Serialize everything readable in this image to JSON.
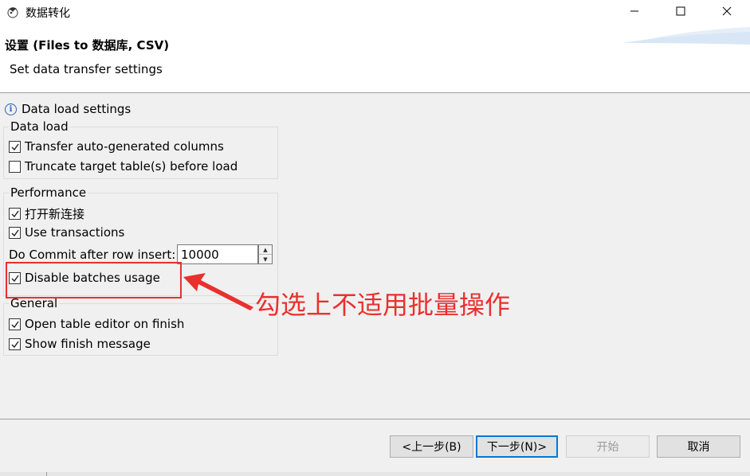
{
  "window": {
    "title": "数据转化",
    "app_icon": "dbeaver-icon",
    "controls": [
      "minimize-icon",
      "maximize-icon",
      "close-icon"
    ]
  },
  "header": {
    "title": "设置 (Files to 数据库, CSV)",
    "description": "Set data transfer settings"
  },
  "info": {
    "icon": "info-icon",
    "label": "Data load settings"
  },
  "data_load": {
    "label": "Data load",
    "transfer_auto": {
      "label": "Transfer auto-generated columns",
      "checked": true
    },
    "truncate": {
      "label": "Truncate target table(s) before load",
      "checked": false
    }
  },
  "performance": {
    "label": "Performance",
    "open_new_conn": {
      "label": "打开新连接",
      "checked": true
    },
    "use_transactions": {
      "label": "Use transactions",
      "checked": true
    },
    "commit_label": "Do Commit after row insert:",
    "commit_value": "10000",
    "disable_batches": {
      "label": "Disable batches usage",
      "checked": true
    }
  },
  "general": {
    "label": "General",
    "open_editor": {
      "label": "Open table editor on finish",
      "checked": true
    },
    "show_finish": {
      "label": "Show finish message",
      "checked": true
    }
  },
  "annotation": {
    "text": "勾选上不适用批量操作",
    "color": "#e8312e"
  },
  "buttons": {
    "back": "<上一步(B)",
    "next": "下一步(N)>",
    "start": "开始",
    "cancel": "取消"
  },
  "colors": {
    "accent": "#0078d7",
    "annotation": "#e8312e"
  }
}
